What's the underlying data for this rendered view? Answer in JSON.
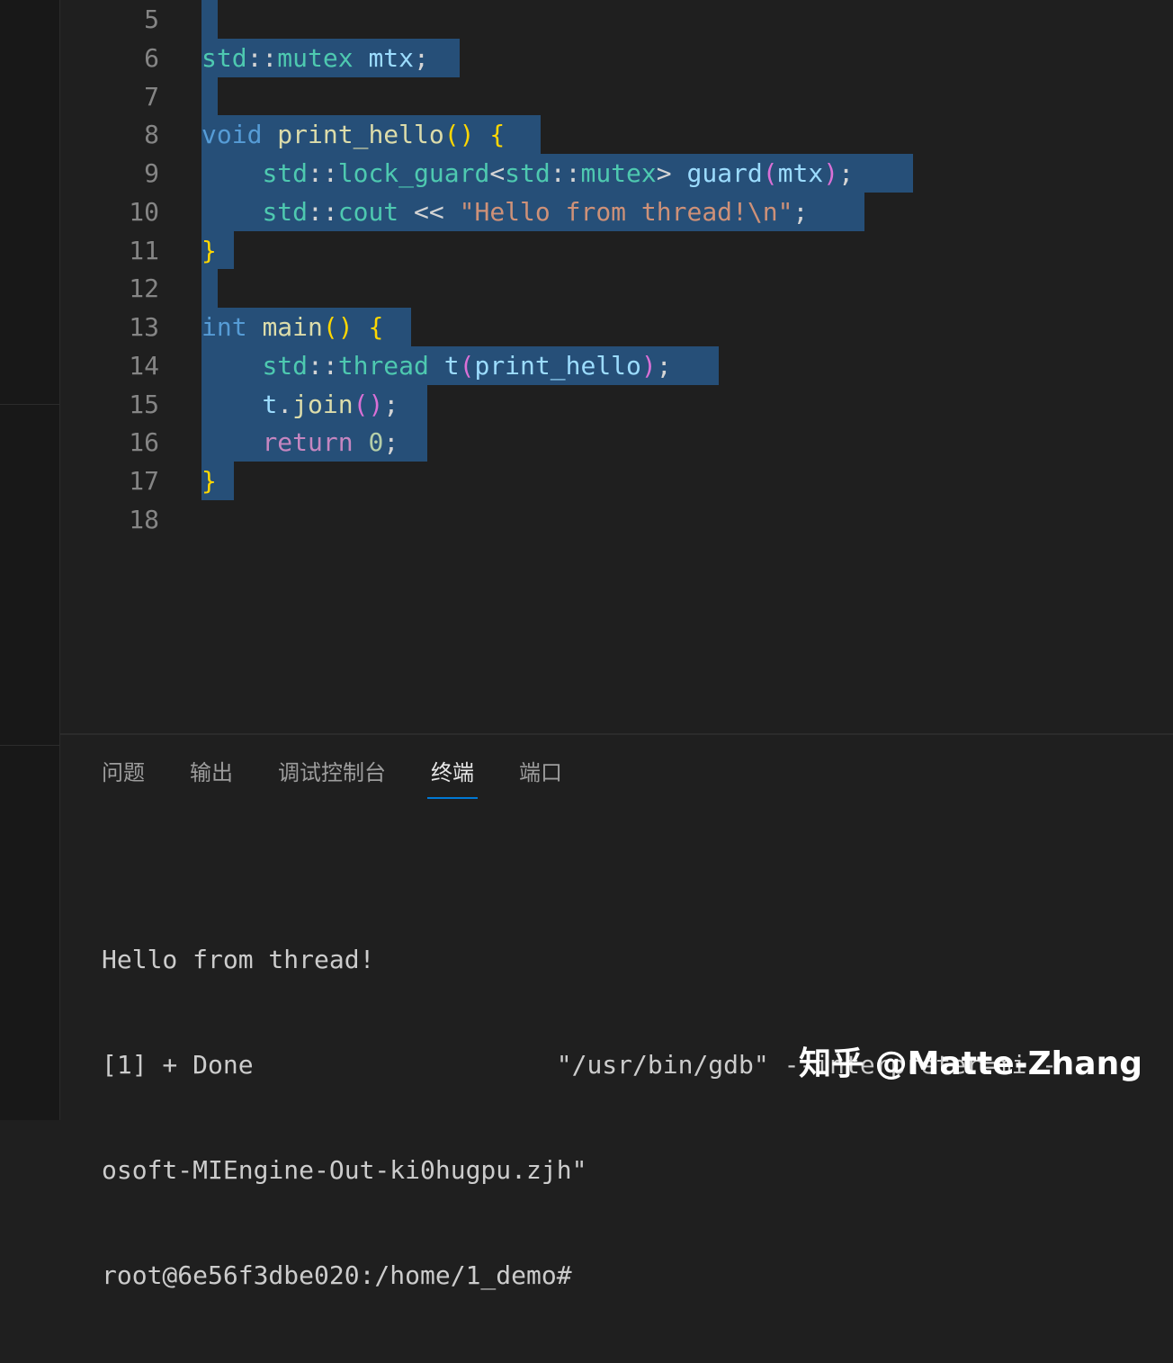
{
  "editor": {
    "line_numbers": [
      "5",
      "6",
      "7",
      "8",
      "9",
      "10",
      "11",
      "12",
      "13",
      "14",
      "15",
      "16",
      "17",
      "18"
    ],
    "lines": {
      "l6": [
        "std",
        "::",
        "mutex",
        " ",
        "mtx",
        ";"
      ],
      "l8": [
        "void",
        " ",
        "print_hello",
        "(",
        ")",
        " ",
        "{"
      ],
      "l9": [
        "    ",
        "std",
        "::",
        "lock_guard",
        "<",
        "std",
        "::",
        "mutex",
        ">",
        " ",
        "guard",
        "(",
        "mtx",
        ")",
        ";"
      ],
      "l10": [
        "    ",
        "std",
        "::",
        "cout",
        " ",
        "<<",
        " ",
        "\"Hello from thread!\\n\"",
        ";"
      ],
      "l11": [
        "}"
      ],
      "l13": [
        "int",
        " ",
        "main",
        "(",
        ")",
        " ",
        "{"
      ],
      "l14": [
        "    ",
        "std",
        "::",
        "thread",
        " ",
        "t",
        "(",
        "print_hello",
        ")",
        ";"
      ],
      "l15": [
        "    ",
        "t",
        ".",
        "join",
        "(",
        ")",
        ";"
      ],
      "l16": [
        "    ",
        "return",
        " ",
        "0",
        ";"
      ],
      "l17": [
        "}"
      ]
    }
  },
  "panel": {
    "tabs": [
      {
        "label": "问题"
      },
      {
        "label": "输出"
      },
      {
        "label": "调试控制台"
      },
      {
        "label": "终端",
        "active": true
      },
      {
        "label": "端口"
      }
    ],
    "terminal_lines": [
      "Hello from thread!",
      "[1] + Done                    \"/usr/bin/gdb\" --interpreter=mi -",
      "osoft-MIEngine-Out-ki0hugpu.zjh\"",
      "root@6e56f3dbe020:/home/1_demo#"
    ]
  },
  "watermark": "知乎 @Matte-Zhang",
  "colors": {
    "selection": "#264f78",
    "keyword": "#569cd6",
    "type": "#4ec9b0",
    "function": "#dcdcaa",
    "variable": "#9cdcfe",
    "string": "#ce9178",
    "active_tab_underline": "#0078d4"
  }
}
